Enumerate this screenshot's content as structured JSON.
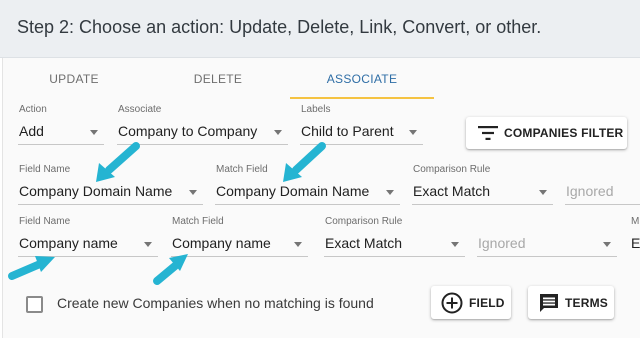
{
  "header": {
    "title": "Step 2: Choose an action: Update, Delete, Link, Convert, or other."
  },
  "tabs": [
    {
      "label": "UPDATE"
    },
    {
      "label": "DELETE"
    },
    {
      "label": "ASSOCIATE"
    }
  ],
  "active_tab": "ASSOCIATE",
  "row1": {
    "action": {
      "label": "Action",
      "value": "Add"
    },
    "associate": {
      "label": "Associate",
      "value": "Company to Company"
    },
    "labels": {
      "label": "Labels",
      "value": "Child to Parent"
    },
    "filter_button": "COMPANIES FILTER"
  },
  "row2": {
    "field_name": {
      "label": "Field Name",
      "value": "Company Domain Name"
    },
    "match_field": {
      "label": "Match Field",
      "value": "Company Domain Name"
    },
    "comparison_rule": {
      "label": "Comparison Rule",
      "value": "Exact Match"
    },
    "ignored": {
      "placeholder": "Ignored"
    }
  },
  "row3": {
    "field_name": {
      "label": "Field Name",
      "value": "Company name"
    },
    "match_field": {
      "label": "Match Field",
      "value": "Company name"
    },
    "comparison_rule": {
      "label": "Comparison Rule",
      "value": "Exact Match"
    },
    "ignored": {
      "placeholder": "Ignored"
    },
    "cut_label": "M",
    "cut_value": "Er"
  },
  "footer": {
    "checkbox_label": "Create new Companies when no matching is found",
    "field_button": "FIELD",
    "terms_button": "TERMS"
  },
  "colors": {
    "accent_arrow": "#25b4d2",
    "tab_active": "#2f6ea6",
    "tab_underline": "#f5c342"
  },
  "icons": [
    "filter-icon",
    "add-circle-icon",
    "comment-icon",
    "pointer-arrow"
  ]
}
